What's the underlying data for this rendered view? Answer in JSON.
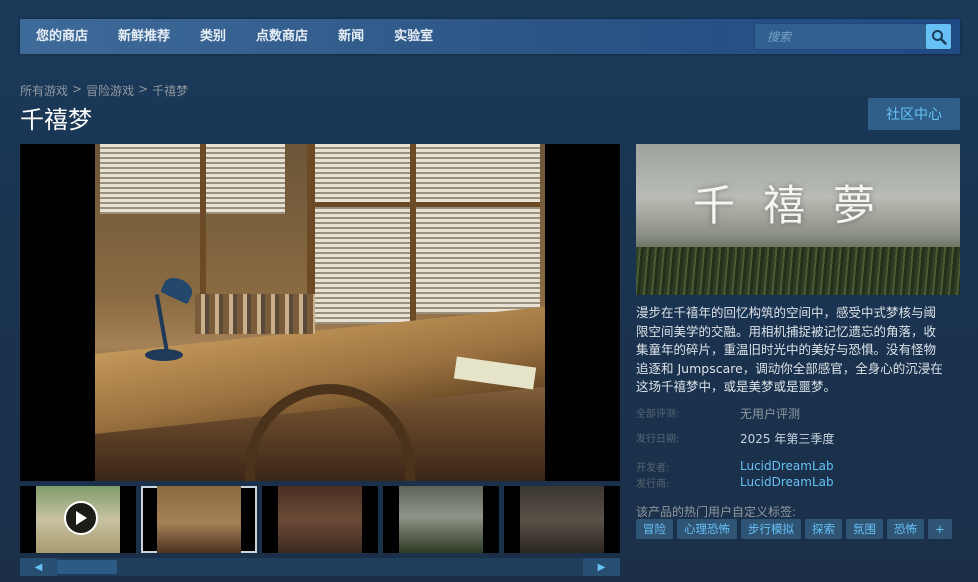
{
  "nav": {
    "items": [
      "您的商店",
      "新鲜推荐",
      "类别",
      "点数商店",
      "新闻",
      "实验室"
    ],
    "search_placeholder": "搜索"
  },
  "breadcrumb": [
    "所有游戏",
    "冒险游戏",
    "千禧梦"
  ],
  "breadcrumb_sep": ">",
  "title": "千禧梦",
  "community_button": "社区中心",
  "capsule_logo": "千禧夢",
  "description": "漫步在千禧年的回忆构筑的空间中，感受中式梦核与阈限空间美学的交融。用相机捕捉被记忆遗忘的角落，收集童年的碎片，重温旧时光中的美好与恐惧。没有怪物追逐和 Jumpscare，调动你全部感官，全身心的沉浸在这场千禧梦中，或是美梦或是噩梦。",
  "info": {
    "reviews_key": "全部评测:",
    "reviews_value": "无用户评测",
    "release_key": "发行日期:",
    "release_value": "2025 年第三季度",
    "developer_key": "开发者:",
    "developer_value": "LucidDreamLab",
    "publisher_key": "发行商:",
    "publisher_value": "LucidDreamLab"
  },
  "tags_label": "该产品的热门用户自定义标签:",
  "tags": [
    "冒险",
    "心理恐怖",
    "步行模拟",
    "探索",
    "氛围",
    "恐怖",
    "+"
  ],
  "scroll": {
    "left": "◀",
    "right": "▶"
  },
  "colors": {
    "accent": "#66c0f4",
    "nav_bg": "#2c5585",
    "bg": "#1b3a5a"
  }
}
